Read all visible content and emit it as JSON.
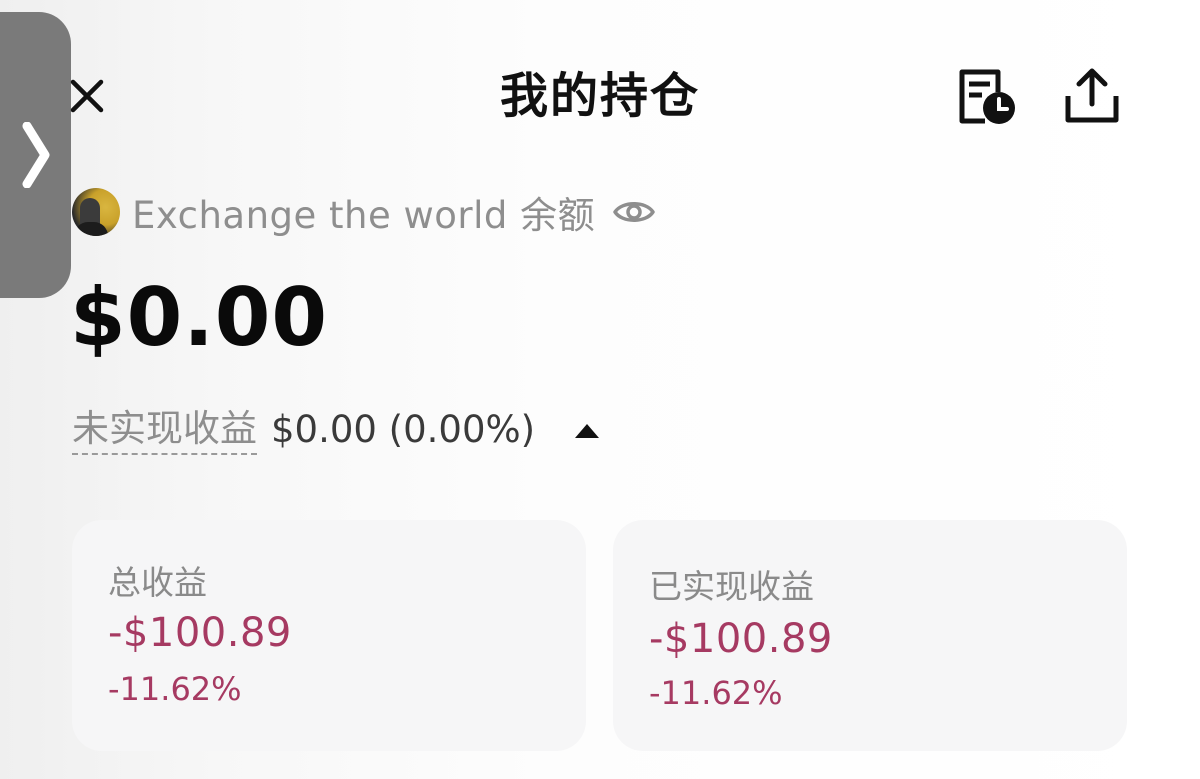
{
  "header": {
    "title": "我的持仓",
    "close_icon": "close-icon",
    "history_icon": "order-history-clock-icon",
    "share_icon": "share-upload-icon"
  },
  "side_panel": {
    "icon": "chevron-right-icon"
  },
  "account": {
    "label": "Exchange the world 余额",
    "visibility_icon": "eye-icon"
  },
  "balance": {
    "amount": "$0.00"
  },
  "unrealized": {
    "label": "未实现收益",
    "value": "$0.00 (0.00%)",
    "toggle_icon": "caret-up-icon"
  },
  "cards": [
    {
      "title": "总收益",
      "amount": "-$100.89",
      "percent": "-11.62%"
    },
    {
      "title": "已实现收益",
      "amount": "-$100.89",
      "percent": "-11.62%"
    }
  ],
  "colors": {
    "negative": "#a63a62",
    "muted_text": "#8e8e8e",
    "card_bg": "#f6f6f7",
    "side_handle": "#7a7a7a"
  }
}
